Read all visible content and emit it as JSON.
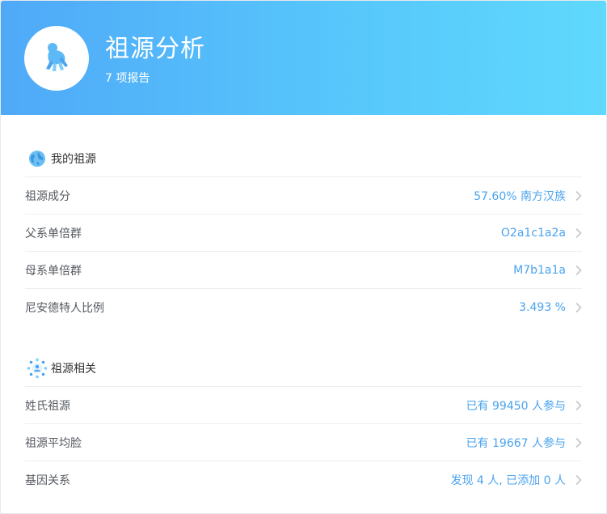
{
  "header": {
    "title": "祖源分析",
    "subtitle": "7 项报告",
    "avatar_icon": "ape-icon",
    "gradient_colors": [
      "#4fa9f8",
      "#5fd9fc"
    ]
  },
  "sections": [
    {
      "title": "我的祖源",
      "icon": "globe-icon",
      "rows": [
        {
          "label": "祖源成分",
          "value": "57.60% 南方汉族"
        },
        {
          "label": "父系单倍群",
          "value": "O2a1c1a2a"
        },
        {
          "label": "母系单倍群",
          "value": "M7b1a1a"
        },
        {
          "label": "尼安德特人比例",
          "value": "3.493 %"
        }
      ]
    },
    {
      "title": "祖源相关",
      "icon": "people-network-icon",
      "rows": [
        {
          "label": "姓氏祖源",
          "value": "已有 99450 人参与"
        },
        {
          "label": "祖源平均脸",
          "value": "已有 19667 人参与"
        },
        {
          "label": "基因关系",
          "value": "发现 4 人, 已添加 0 人"
        }
      ]
    }
  ],
  "colors": {
    "accent": "#4aa3ee",
    "label": "#555a60",
    "divider": "#eceef1"
  }
}
